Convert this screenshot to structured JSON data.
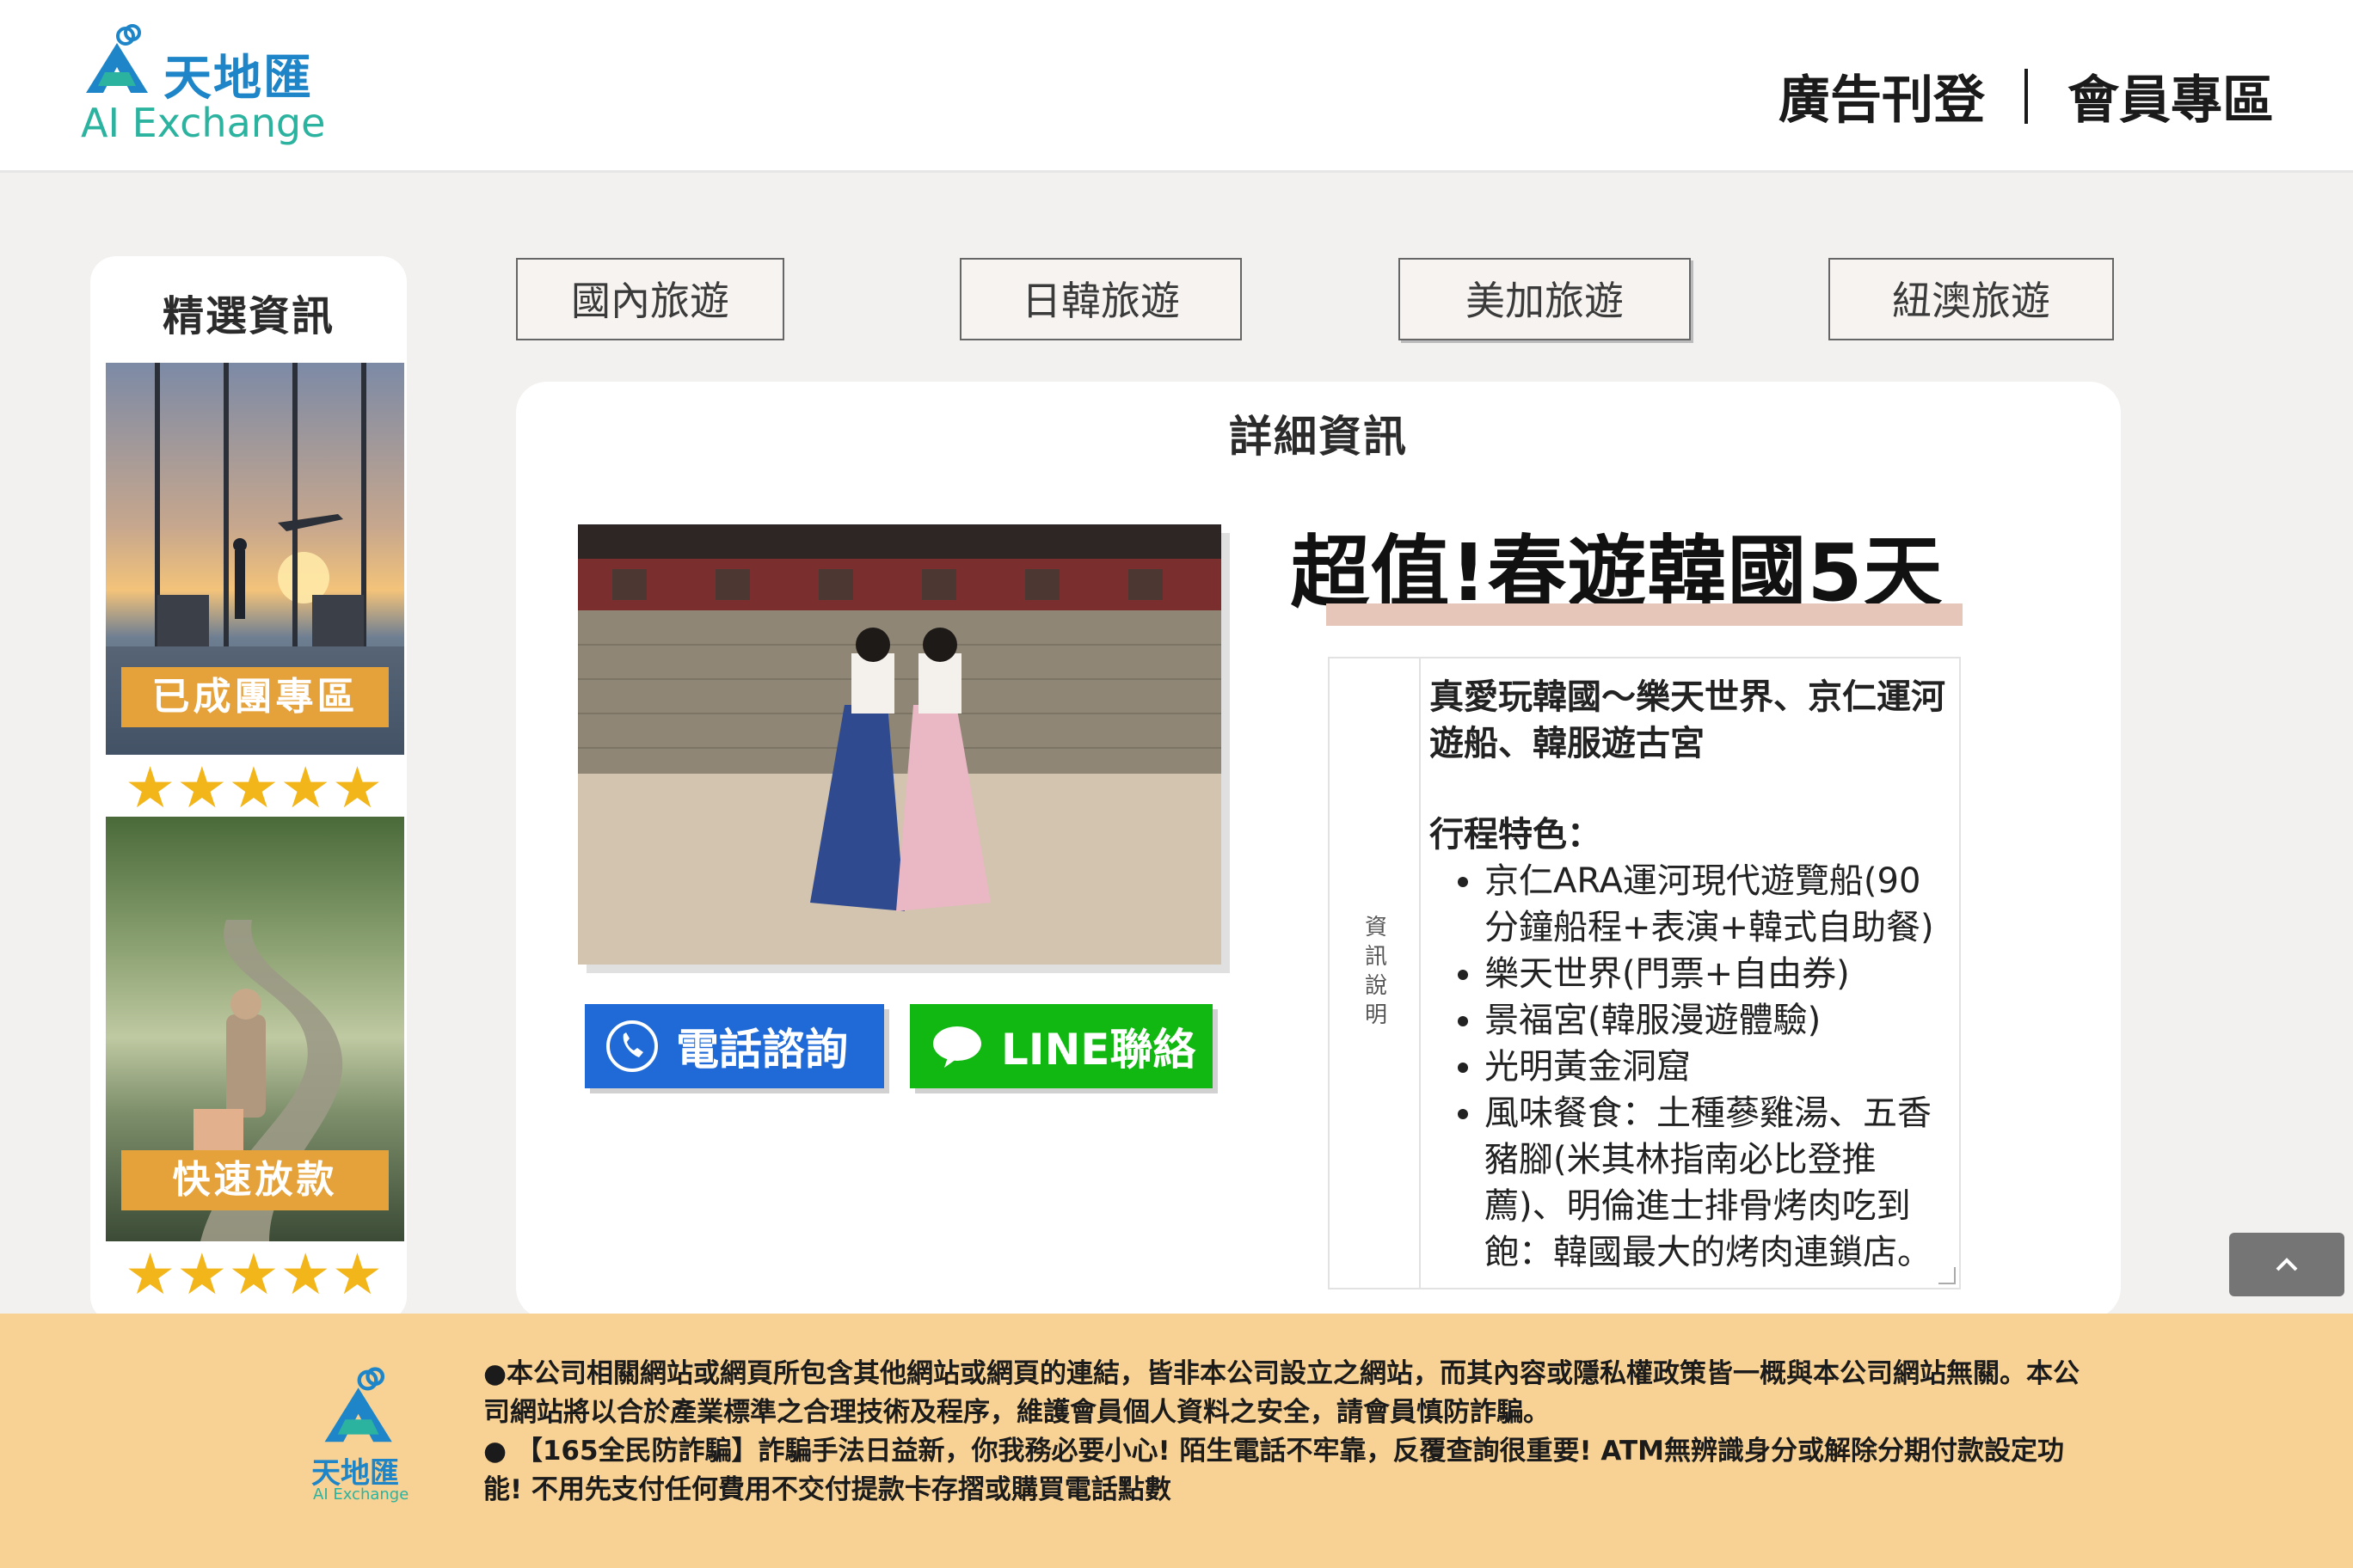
{
  "brand": {
    "name_cn": "天地匯",
    "name_en": "AI Exchange",
    "colors": {
      "blue": "#1e86c8",
      "teal": "#2bb3a0"
    }
  },
  "nav": {
    "items": [
      "廣告刊登",
      "會員專區"
    ],
    "separator": "|"
  },
  "sidebar": {
    "title": "精選資訊",
    "promos": [
      {
        "label": "已成團專區",
        "stars": 5
      },
      {
        "label": "快速放款",
        "stars": 5
      }
    ]
  },
  "tabs": [
    "國內旅遊",
    "日韓旅遊",
    "美加旅遊",
    "紐澳旅遊"
  ],
  "detail": {
    "panel_title": "詳細資訊",
    "trip_title": "超值!春遊韓國5天",
    "info_label": "資訊說明",
    "intro": "真愛玩韓國～樂天世界、京仁運河遊船、韓服遊古宮",
    "features_heading": "行程特色：",
    "features": [
      "京仁ARA運河現代遊覽船(90分鐘船程+表演+韓式自助餐)",
      "樂天世界(門票+自由券)",
      "景福宮(韓服漫遊體驗)",
      "光明黃金洞窟",
      "風味餐食：土種蔘雞湯、五香豬腳(米其林指南必比登推薦)、明倫進士排骨烤肉吃到飽：韓國最大的烤肉連鎖店。"
    ]
  },
  "buttons": {
    "phone_label": "電話諮詢",
    "line_label": "LINE聯絡",
    "phone_color": "#1f6ad6",
    "line_color": "#12b812"
  },
  "footer": {
    "disclaimer_1": "●本公司相關網站或網頁所包含其他網站或網頁的連結，皆非本公司設立之網站，而其內容或隱私權政策皆一概與本公司網站無關。本公司網站將以合於產業標準之合理技術及程序，維護會員個人資料之安全，請會員慎防詐騙。",
    "disclaimer_2": "● 【165全民防詐騙】詐騙手法日益新，你我務必要小心! 陌生電話不牢靠，反覆查詢很重要! ATM無辨識身分或解除分期付款設定功能! 不用先支付任何費用不交付提款卡存摺或購買電話點數",
    "background": "#f8d294"
  }
}
